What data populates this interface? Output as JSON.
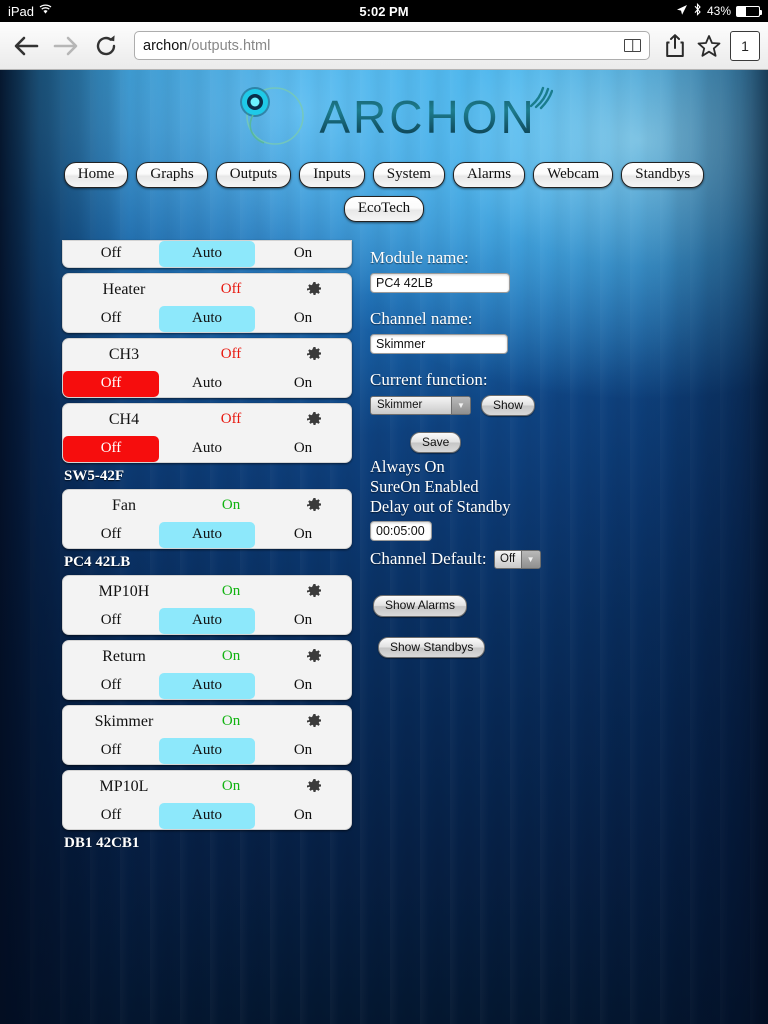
{
  "status_bar": {
    "device": "iPad",
    "wifi_icon": "wifi-icon",
    "time": "5:02 PM",
    "location_icon": "location-arrow-icon",
    "bluetooth_icon": "bluetooth-icon",
    "battery_percent": "43%",
    "battery_level": 43
  },
  "browser": {
    "back_icon": "back-arrow-icon",
    "forward_icon": "forward-arrow-icon",
    "reload_icon": "reload-icon",
    "url_host": "archon",
    "url_path": "/outputs.html",
    "reader_icon": "reader-view-icon",
    "share_icon": "share-icon",
    "bookmark_icon": "star-icon",
    "tab_count": "1"
  },
  "brand": {
    "name": "ARCHON",
    "logo_icon": "archon-logo-icon"
  },
  "nav": {
    "row1": [
      {
        "label": "Home"
      },
      {
        "label": "Graphs"
      },
      {
        "label": "Outputs"
      },
      {
        "label": "Inputs"
      },
      {
        "label": "System"
      },
      {
        "label": "Alarms"
      },
      {
        "label": "Webcam"
      },
      {
        "label": "Standbys"
      }
    ],
    "row2": [
      {
        "label": "EcoTech"
      }
    ]
  },
  "outputs": {
    "segments": {
      "off": "Off",
      "auto": "Auto",
      "on": "On"
    },
    "gear_icon": "gear-icon",
    "groups": [
      {
        "title": "",
        "title_visible": false,
        "channels": [
          {
            "name": "",
            "state": "",
            "state_kind": "none",
            "selected": "auto",
            "clipped_top": true
          },
          {
            "name": "Heater",
            "state": "Off",
            "state_kind": "off",
            "selected": "auto",
            "clipped_top": false
          },
          {
            "name": "CH3",
            "state": "Off",
            "state_kind": "off",
            "selected": "off",
            "clipped_top": false
          },
          {
            "name": "CH4",
            "state": "Off",
            "state_kind": "off",
            "selected": "off",
            "clipped_top": false
          }
        ]
      },
      {
        "title": "SW5-42F",
        "title_visible": true,
        "channels": [
          {
            "name": "Fan",
            "state": "On",
            "state_kind": "on",
            "selected": "auto",
            "clipped_top": false
          }
        ]
      },
      {
        "title": "PC4 42LB",
        "title_visible": true,
        "channels": [
          {
            "name": "MP10H",
            "state": "On",
            "state_kind": "on",
            "selected": "auto",
            "clipped_top": false
          },
          {
            "name": "Return",
            "state": "On",
            "state_kind": "on",
            "selected": "auto",
            "clipped_top": false
          },
          {
            "name": "Skimmer",
            "state": "On",
            "state_kind": "on",
            "selected": "auto",
            "clipped_top": false
          },
          {
            "name": "MP10L",
            "state": "On",
            "state_kind": "on",
            "selected": "auto",
            "clipped_top": false
          }
        ]
      }
    ],
    "cut_off_group_title": "DB1 42CB1"
  },
  "detail": {
    "module_name_label": "Module name:",
    "module_name_value": "PC4 42LB",
    "channel_name_label": "Channel name:",
    "channel_name_value": "Skimmer",
    "current_function_label": "Current function:",
    "current_function_value": "Skimmer",
    "show_button": "Show",
    "save_button": "Save",
    "always_on": "Always On",
    "sureon_enabled": "SureOn Enabled",
    "delay_out_of_standby": "Delay out of Standby",
    "delay_value": "00:05:00",
    "channel_default_label": "Channel Default:",
    "channel_default_value": "Off",
    "show_alarms_button": "Show Alarms",
    "show_standbys_button": "Show Standbys"
  },
  "colors": {
    "auto_selected": "#8de8fb",
    "off_selected": "#f60d0d",
    "state_on": "#12b312",
    "state_off": "#e8180f",
    "card_bg": "#f3f3f3"
  }
}
